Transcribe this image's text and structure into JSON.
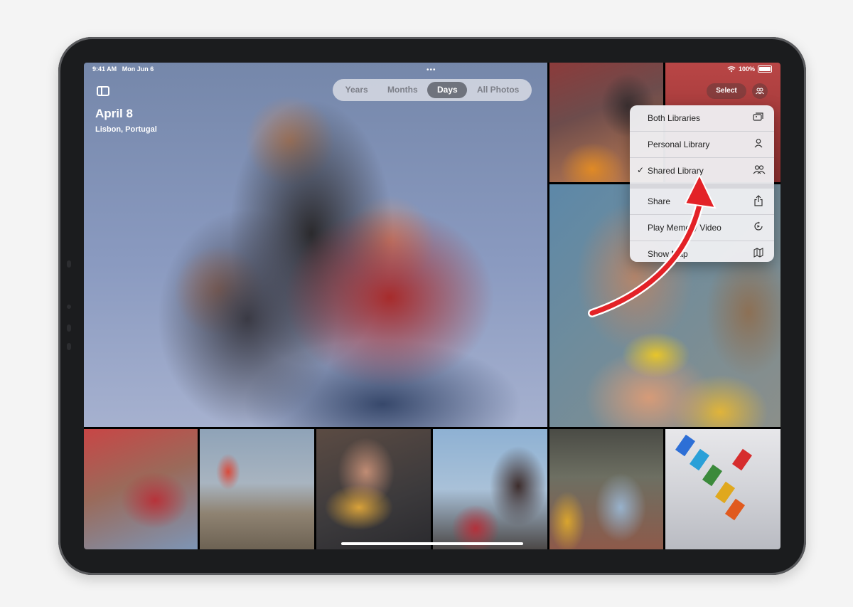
{
  "status_bar": {
    "time": "9:41 AM",
    "date": "Mon Jun 6",
    "battery": "100%",
    "wifi_icon": "wifi-icon",
    "battery_icon": "battery-icon"
  },
  "header": {
    "date_title": "April 8",
    "location": "Lisbon, Portugal",
    "sidebar_icon": "sidebar-icon"
  },
  "segmented_control": {
    "options": [
      "Years",
      "Months",
      "Days",
      "All Photos"
    ],
    "selected": "Days"
  },
  "toolbar": {
    "select_label": "Select",
    "people_icon": "people-icon"
  },
  "menu": {
    "items": [
      {
        "label": "Both Libraries",
        "icon": "photos-stack-icon",
        "checked": false
      },
      {
        "label": "Personal Library",
        "icon": "person-icon",
        "checked": false
      },
      {
        "label": "Shared Library",
        "icon": "two-people-icon",
        "checked": true
      },
      {
        "label": "Share",
        "icon": "share-icon",
        "checked": false
      },
      {
        "label": "Play Memory Video",
        "icon": "play-memory-icon",
        "checked": false
      },
      {
        "label": "Show Map",
        "icon": "map-icon",
        "checked": false
      }
    ],
    "check_mark": "✓"
  },
  "colors": {
    "arrow": "#e32227",
    "menu_bg": "#eeeef1",
    "segment_active": "#6f737d"
  }
}
